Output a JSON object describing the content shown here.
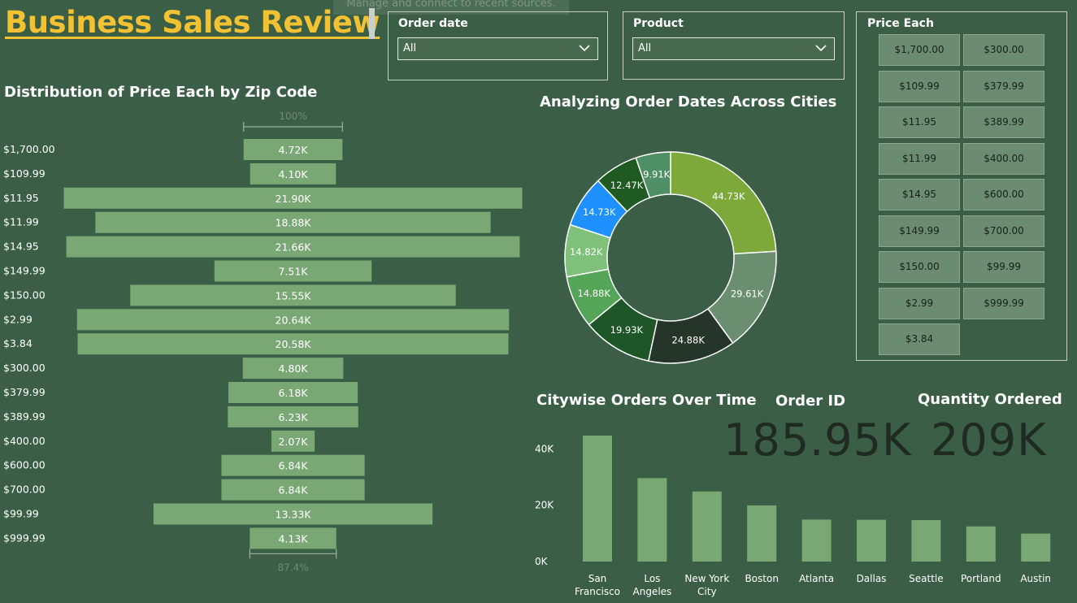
{
  "title": "Business Sales Review",
  "tooltip_text": "Manage and connect to recent sources.",
  "filters": {
    "order_date": {
      "label": "Order date",
      "value": "All"
    },
    "product": {
      "label": "Product",
      "value": "All"
    },
    "price_each": {
      "label": "Price Each",
      "options": [
        "$1,700.00",
        "$300.00",
        "$109.99",
        "$379.99",
        "$11.95",
        "$389.99",
        "$11.99",
        "$400.00",
        "$14.95",
        "$600.00",
        "$149.99",
        "$700.00",
        "$150.00",
        "$99.99",
        "$2.99",
        "$999.99",
        "$3.84"
      ]
    }
  },
  "kpis": {
    "order_id": {
      "label": "Order ID",
      "value": "185.95K"
    },
    "quantity": {
      "label": "Quantity Ordered",
      "value": "209K"
    }
  },
  "colors": {
    "background": "#3b5e46",
    "title": "#f2c233",
    "bar": "#7aa874",
    "donut": [
      "#7ca93a",
      "#6a8f70",
      "#26352a",
      "#1e5628",
      "#55a558",
      "#7fc07a",
      "#1e90ff",
      "#1f5a22",
      "#4f8f66"
    ]
  },
  "chart_data": [
    {
      "type": "bar",
      "orientation": "horizontal-funnel",
      "title": "Distribution of Price Each by Zip Code",
      "categories": [
        "$1,700.00",
        "$109.99",
        "$11.95",
        "$11.99",
        "$14.95",
        "$149.99",
        "$150.00",
        "$2.99",
        "$3.84",
        "$300.00",
        "$379.99",
        "$389.99",
        "$400.00",
        "$600.00",
        "$700.00",
        "$99.99",
        "$999.99"
      ],
      "values": [
        4720,
        4100,
        21900,
        18880,
        21660,
        7510,
        15550,
        20640,
        20580,
        4800,
        6180,
        6230,
        2070,
        6840,
        6840,
        13330,
        4130
      ],
      "data_labels": [
        "4.72K",
        "4.10K",
        "21.90K",
        "18.88K",
        "21.66K",
        "7.51K",
        "15.55K",
        "20.64K",
        "20.58K",
        "4.80K",
        "6.18K",
        "6.23K",
        "2.07K",
        "6.84K",
        "6.84K",
        "13.33K",
        "4.13K"
      ],
      "top_annotation": "100%",
      "bottom_annotation": "87.4%"
    },
    {
      "type": "pie",
      "subtype": "donut",
      "title": "Analyzing Order Dates Across Cities",
      "values": [
        44730,
        29610,
        24880,
        19930,
        14880,
        14820,
        14730,
        12470,
        9910
      ],
      "data_labels": [
        "44.73K",
        "29.61K",
        "24.88K",
        "19.93K",
        "14.88K",
        "14.82K",
        "14.73K",
        "12.47K",
        "9.91K"
      ]
    },
    {
      "type": "bar",
      "title": "Citywise Orders Over Time",
      "categories": [
        "San Francisco",
        "Los Angeles",
        "New York City",
        "Boston",
        "Atlanta",
        "Dallas",
        "Seattle",
        "Portland",
        "Austin"
      ],
      "category_lines": [
        [
          "San",
          "Francisco"
        ],
        [
          "Los",
          "Angeles"
        ],
        [
          "New York",
          "City"
        ],
        [
          "Boston"
        ],
        [
          "Atlanta"
        ],
        [
          "Dallas"
        ],
        [
          "Seattle"
        ],
        [
          "Portland"
        ],
        [
          "Austin"
        ]
      ],
      "values": [
        44730,
        29610,
        24880,
        19930,
        14880,
        14820,
        14730,
        12470,
        9910
      ],
      "yticks": [
        "0K",
        "20K",
        "40K"
      ],
      "ylim": [
        0,
        45000
      ]
    }
  ]
}
